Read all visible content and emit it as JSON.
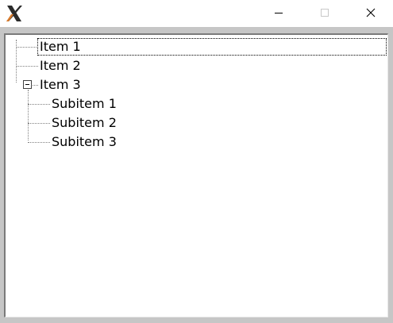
{
  "window": {
    "app_icon": "x-app-icon",
    "controls": {
      "minimize": "minimize-icon",
      "maximize": "maximize-icon",
      "close": "close-icon"
    }
  },
  "tree": {
    "items": [
      {
        "label": "Item 1",
        "selected": true
      },
      {
        "label": "Item 2"
      },
      {
        "label": "Item 3",
        "expanded": true,
        "children": [
          {
            "label": "Subitem 1"
          },
          {
            "label": "Subitem 2"
          },
          {
            "label": "Subitem 3"
          }
        ]
      }
    ]
  },
  "colors": {
    "frame": "#c6c6c6",
    "tree_background": "#ffffff",
    "connector": "#808080"
  }
}
